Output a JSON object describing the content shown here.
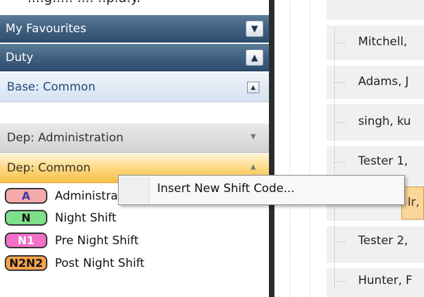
{
  "top_cut_text": "....g..... .... ..p.a.y.",
  "panel": {
    "headers": [
      {
        "label": "My Favourites",
        "state": "collapsed"
      },
      {
        "label": "Duty",
        "state": "expanded"
      }
    ],
    "groups": [
      {
        "label": "Base: Common"
      },
      {
        "label": "Dep: Administration"
      },
      {
        "label": "Dep: Common"
      }
    ],
    "shifts": [
      {
        "code": "A",
        "label": "Administration",
        "color": "#f4aaaa",
        "text_color": "#3a3aa8"
      },
      {
        "code": "N",
        "label": "Night Shift",
        "color": "#7ee08a",
        "text_color": "#111111"
      },
      {
        "code": "N1",
        "label": "Pre Night Shift",
        "color": "#f36fc8",
        "text_color": "#ffffff"
      },
      {
        "code": "N2N2",
        "label": "Post Night Shift",
        "color": "#f6a24d",
        "text_color": "#111111"
      }
    ]
  },
  "right": {
    "names": [
      "Mitchell,",
      "Adams, J",
      "singh, ku",
      "Tester 1,",
      "Tester 2,",
      "Hunter, F"
    ],
    "selected_label": "Ir,"
  },
  "context_menu": {
    "items": [
      "Insert New Shift Code..."
    ]
  }
}
